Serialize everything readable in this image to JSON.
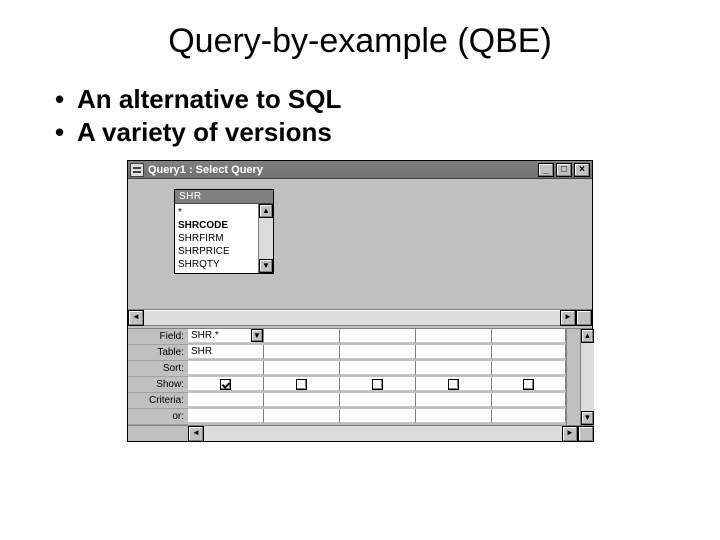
{
  "slide": {
    "title": "Query-by-example (QBE)",
    "bullets": [
      "An alternative to SQL",
      "A variety of versions"
    ]
  },
  "qbe": {
    "window_title": "Query1 : Select Query",
    "titlebar_buttons": {
      "min": "_",
      "max": "□",
      "close": "×"
    },
    "source_table": {
      "name": "SHR",
      "fields": [
        "*",
        "SHRCODE",
        "SHRFIRM",
        "SHRPRICE",
        "SHRQTY"
      ]
    },
    "grid": {
      "rows": [
        "Field:",
        "Table:",
        "Sort:",
        "Show:",
        "Criteria:",
        "or:"
      ],
      "columns": [
        {
          "field": "SHR.*",
          "table": "SHR",
          "sort": "",
          "show": true,
          "criteria": "",
          "or": ""
        },
        {
          "field": "",
          "table": "",
          "sort": "",
          "show": false,
          "criteria": "",
          "or": ""
        },
        {
          "field": "",
          "table": "",
          "sort": "",
          "show": false,
          "criteria": "",
          "or": ""
        },
        {
          "field": "",
          "table": "",
          "sort": "",
          "show": false,
          "criteria": "",
          "or": ""
        },
        {
          "field": "",
          "table": "",
          "sort": "",
          "show": false,
          "criteria": "",
          "or": ""
        }
      ]
    }
  }
}
